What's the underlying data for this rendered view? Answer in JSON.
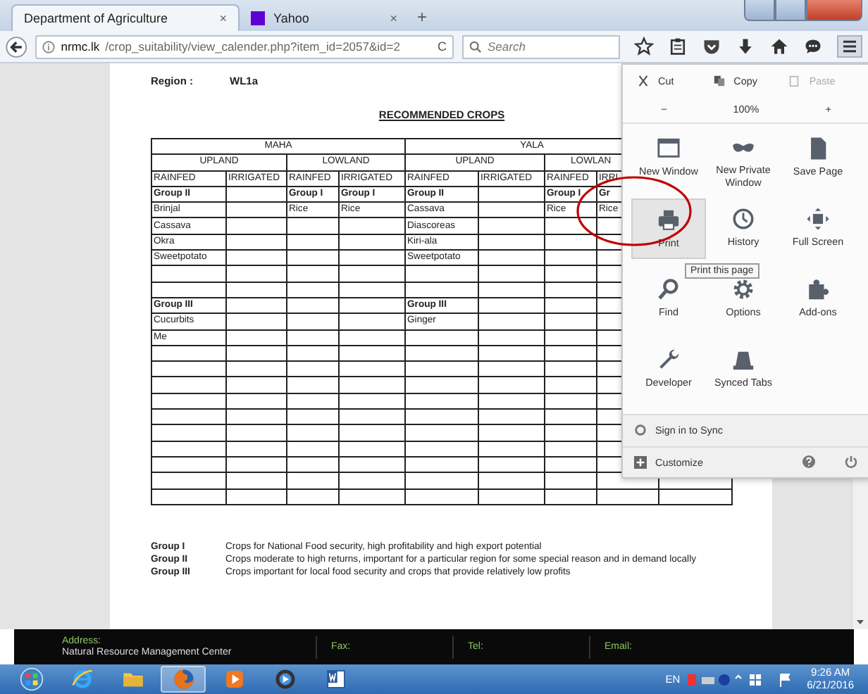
{
  "tabs": [
    {
      "label": "Department of Agriculture",
      "close": "×",
      "selected": true
    },
    {
      "label": "Yahoo",
      "close": "×",
      "selected": false
    }
  ],
  "new_tab": "+",
  "address_bar": {
    "host": "nrmc.lk",
    "path": "/crop_suitability/view_calender.php?item_id=2057&id=2",
    "reload": "C"
  },
  "search": {
    "placeholder": "Search"
  },
  "document": {
    "region_label": "Region :",
    "region_value": "WL1a",
    "heading": "RECOMMENDED CROPS",
    "table": {
      "seasons": [
        "MAHA",
        "YALA"
      ],
      "land_types": [
        "UPLAND",
        "LOWLAND",
        "UPLAND",
        "LOWLAN"
      ],
      "columns": [
        "RAINFED",
        "IRRIGATED",
        "RAINFED",
        "IRRIGATED",
        "RAINFED",
        "IRRIGATED",
        "RAINFED",
        "IRRI"
      ],
      "rows": [
        {
          "kind": "group",
          "cells": [
            "Group II",
            null,
            "Group I",
            "Group I",
            "Group II",
            null,
            "Group I",
            "Gr"
          ]
        },
        {
          "kind": "crop",
          "cells": [
            "Brinjal",
            null,
            "Rice",
            "Rice",
            "Cassava",
            null,
            "Rice",
            "Rice"
          ]
        },
        {
          "kind": "crop",
          "cells": [
            "Cassava",
            null,
            null,
            null,
            "Diascoreas",
            null,
            null,
            null
          ]
        },
        {
          "kind": "crop",
          "cells": [
            "Okra",
            null,
            null,
            null,
            "Kiri-ala",
            null,
            null,
            null
          ]
        },
        {
          "kind": "crop",
          "cells": [
            "Sweetpotato",
            null,
            null,
            null,
            "Sweetpotato",
            null,
            null,
            null
          ]
        },
        {
          "kind": "blank"
        },
        {
          "kind": "blank"
        },
        {
          "kind": "group",
          "cells": [
            "Group III",
            null,
            null,
            null,
            "Group III",
            null,
            null,
            null
          ]
        },
        {
          "kind": "crop",
          "cells": [
            "Cucurbits",
            null,
            null,
            null,
            "Ginger",
            null,
            null,
            null
          ]
        },
        {
          "kind": "crop",
          "cells": [
            "Me",
            null,
            null,
            null,
            null,
            null,
            null,
            null
          ]
        },
        {
          "kind": "blank"
        },
        {
          "kind": "blank"
        },
        {
          "kind": "blank"
        },
        {
          "kind": "blank"
        },
        {
          "kind": "blank"
        },
        {
          "kind": "blank"
        },
        {
          "kind": "blank"
        },
        {
          "kind": "blank"
        },
        {
          "kind": "blank"
        },
        {
          "kind": "blank"
        }
      ]
    },
    "legend": [
      {
        "group": "Group I",
        "text": "Crops for National Food security, high profitability and high export potential"
      },
      {
        "group": "Group II",
        "text": "Crops moderate to high returns,  important for a particular region for some special reason and  in  demand locally"
      },
      {
        "group": "Group III",
        "text": "Crops important for local food security and crops that provide relatively low profits"
      }
    ]
  },
  "menu": {
    "edit": [
      {
        "label": "Cut",
        "disabled": false
      },
      {
        "label": "Copy",
        "disabled": false
      },
      {
        "label": "Paste",
        "disabled": true
      }
    ],
    "zoom": {
      "out": "−",
      "level": "100%",
      "in": "+"
    },
    "items": [
      {
        "label": "New Window",
        "hovered": false,
        "circled": false
      },
      {
        "label": "New Private Window",
        "hovered": false,
        "circled": false
      },
      {
        "label": "Save Page",
        "hovered": false,
        "circled": false
      },
      {
        "label": "Print",
        "hovered": true,
        "circled": true
      },
      {
        "label": "History",
        "hovered": false,
        "circled": false
      },
      {
        "label": "Full Screen",
        "hovered": false,
        "circled": false
      },
      {
        "label": "Find",
        "hovered": false,
        "circled": false
      },
      {
        "label": "Options",
        "hovered": false,
        "circled": false
      },
      {
        "label": "Add-ons",
        "hovered": false,
        "circled": false
      },
      {
        "label": "Developer",
        "hovered": false,
        "circled": false
      },
      {
        "label": "Synced Tabs",
        "hovered": false,
        "circled": false
      }
    ],
    "tooltip": "Print this page",
    "sync": "Sign in to Sync",
    "customize": "Customize"
  },
  "footer": {
    "address_label": "Address:",
    "address": "Natural Resource Management Center",
    "fax_label": "Fax:",
    "tel_label": "Tel:",
    "email_label": "Email:"
  },
  "taskbar": {
    "apps": [
      {
        "selected": false
      },
      {
        "selected": false
      },
      {
        "selected": false
      },
      {
        "selected": true
      },
      {
        "selected": false
      },
      {
        "selected": false
      },
      {
        "selected": false
      }
    ],
    "language": "EN",
    "time": "9:26 AM",
    "date": "6/21/2016"
  }
}
